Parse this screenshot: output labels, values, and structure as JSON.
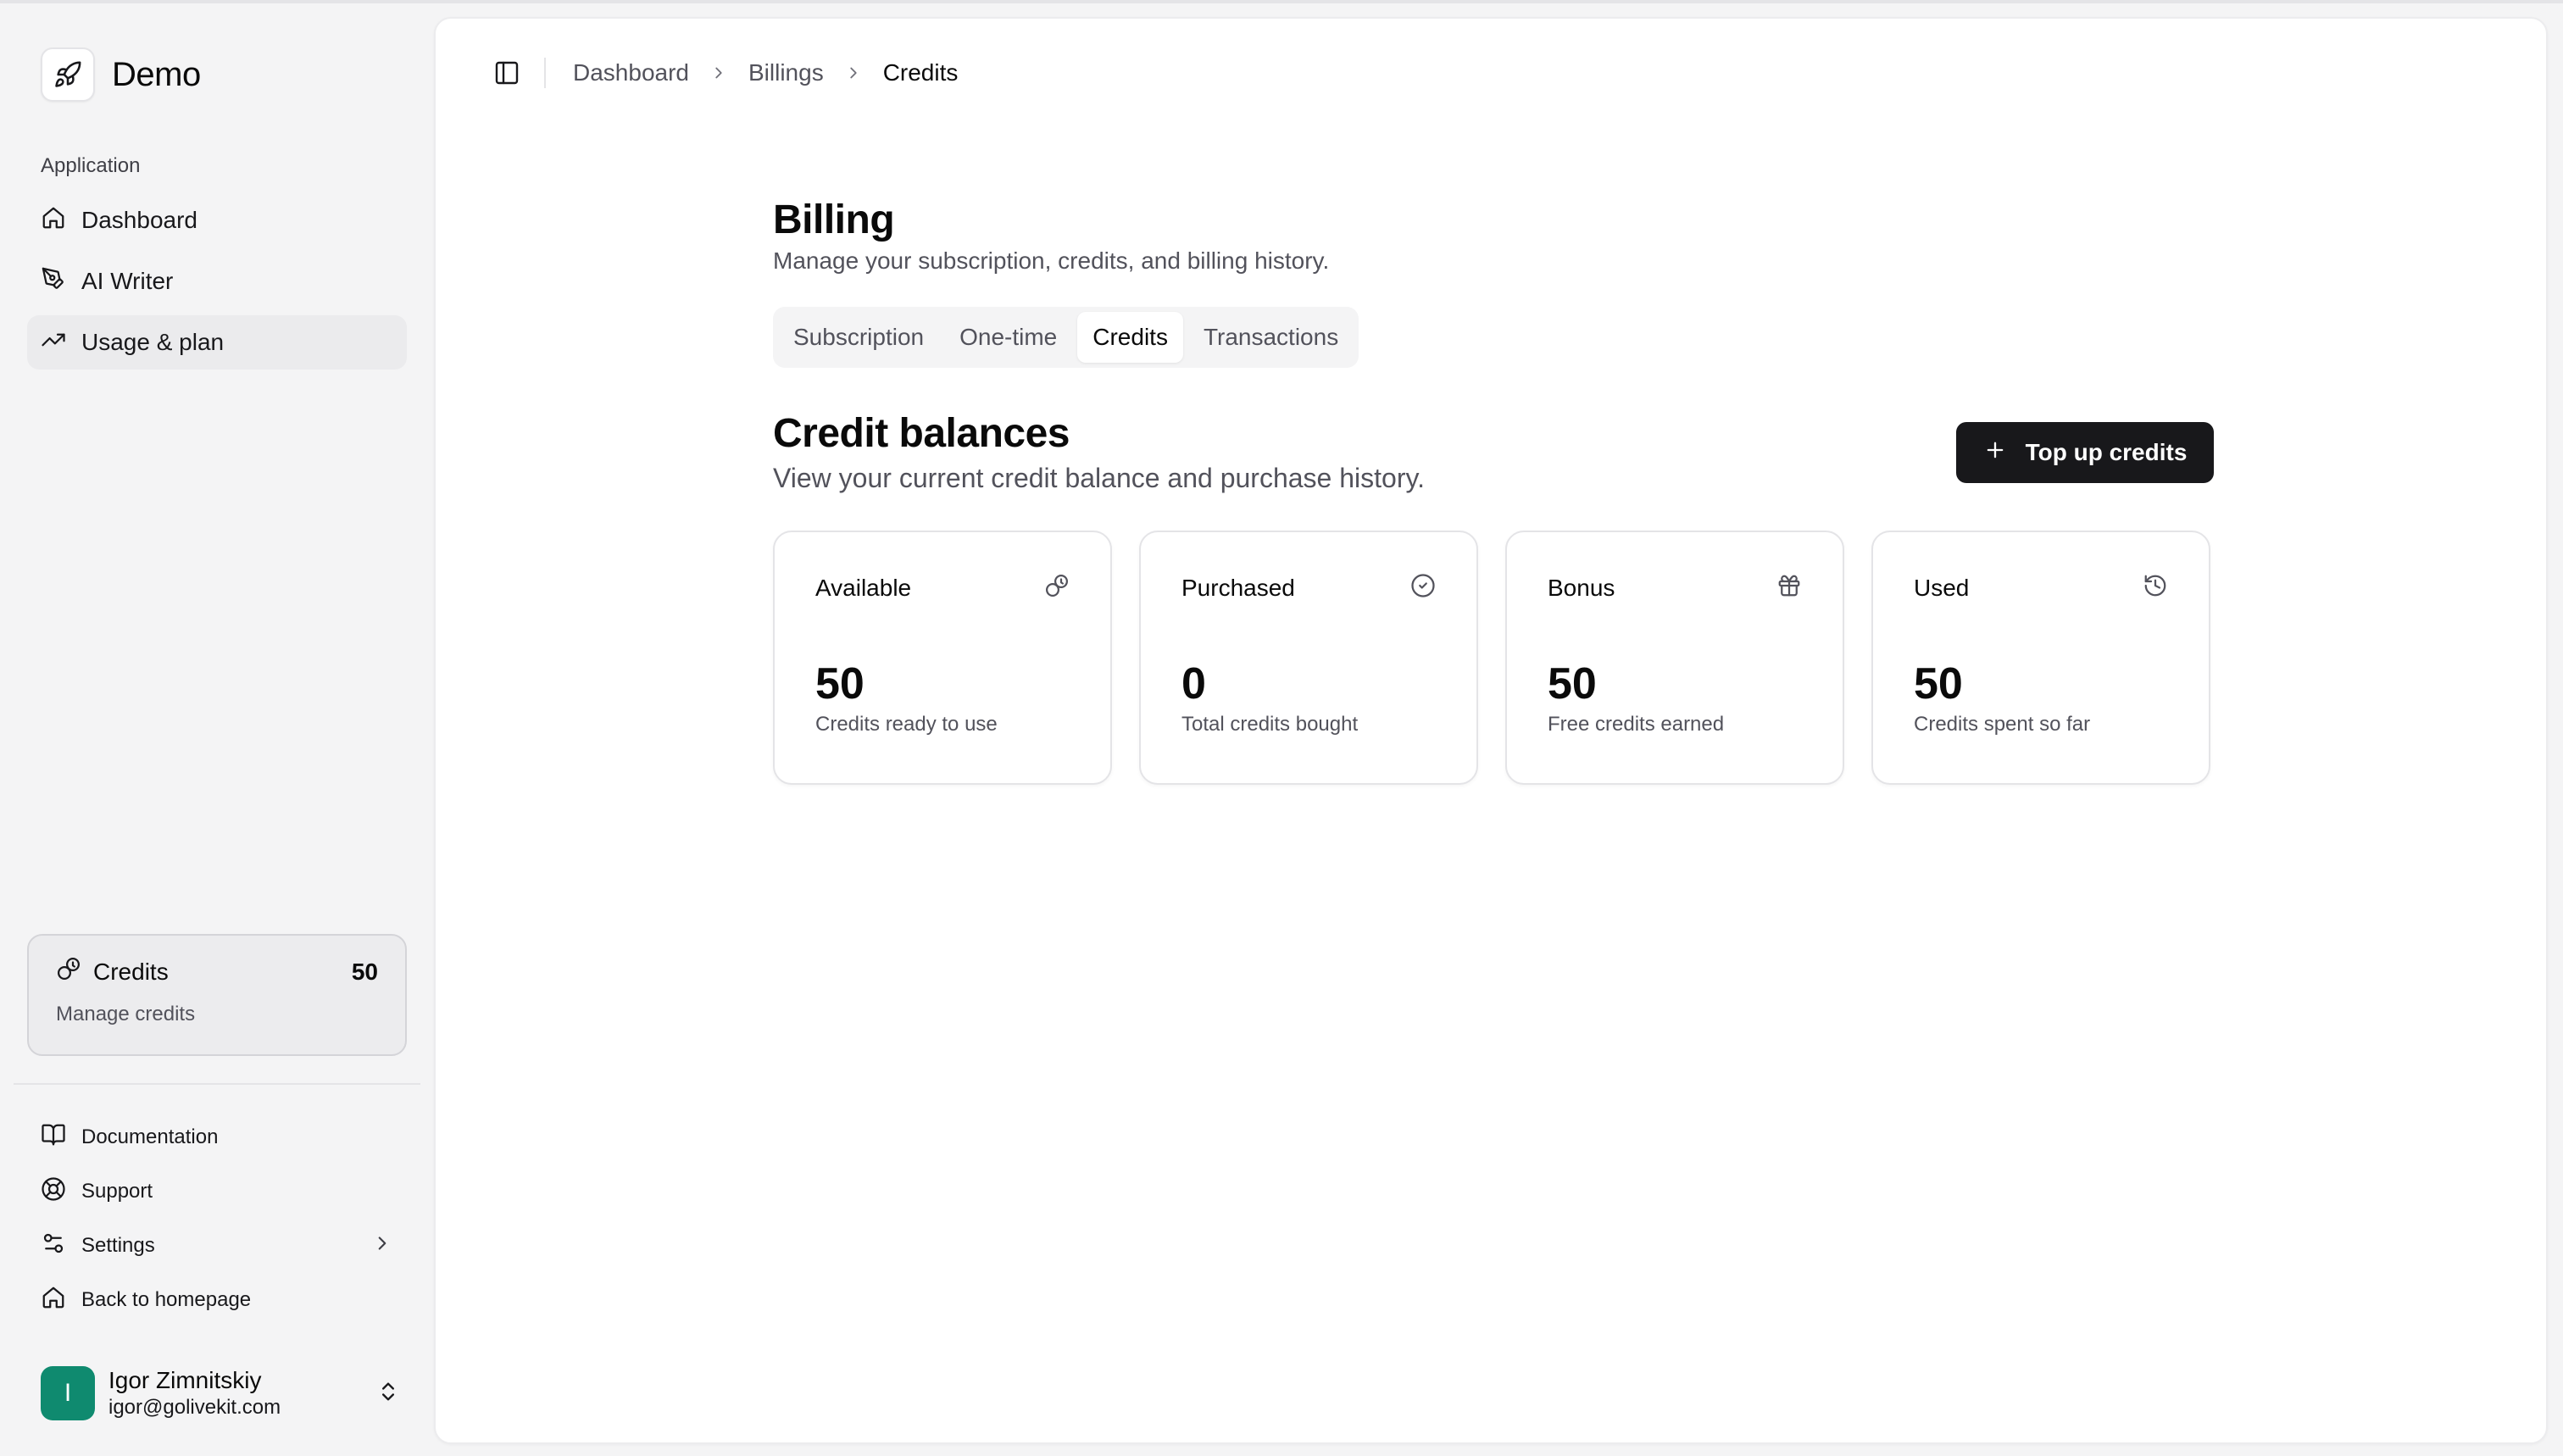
{
  "app": {
    "name": "Demo"
  },
  "sidebar": {
    "section_label": "Application",
    "items": [
      {
        "label": "Dashboard",
        "icon": "home-icon"
      },
      {
        "label": "AI Writer",
        "icon": "pen-tool-icon"
      },
      {
        "label": "Usage & plan",
        "icon": "trending-up-icon",
        "active": true
      }
    ],
    "credits": {
      "label": "Credits",
      "count": "50",
      "sub": "Manage credits"
    },
    "bottom_items": [
      {
        "label": "Documentation",
        "icon": "book-open-icon"
      },
      {
        "label": "Support",
        "icon": "life-buoy-icon"
      },
      {
        "label": "Settings",
        "icon": "settings-sliders-icon"
      },
      {
        "label": "Back to homepage",
        "icon": "home-icon"
      }
    ],
    "user": {
      "initial": "I",
      "name": "Igor Zimnitskiy",
      "email": "igor@golivekit.com"
    }
  },
  "breadcrumb": [
    "Dashboard",
    "Billings",
    "Credits"
  ],
  "page": {
    "title": "Billing",
    "subtitle": "Manage your subscription, credits, and billing history.",
    "tabs": [
      "Subscription",
      "One-time",
      "Credits",
      "Transactions"
    ],
    "active_tab": "Credits"
  },
  "credits_section": {
    "title": "Credit balances",
    "subtitle": "View your current credit balance and purchase history.",
    "topup_label": "Top up credits",
    "cards": [
      {
        "label": "Available",
        "value": "50",
        "desc": "Credits ready to use",
        "icon": "coins-icon"
      },
      {
        "label": "Purchased",
        "value": "0",
        "desc": "Total credits bought",
        "icon": "check-circle-icon"
      },
      {
        "label": "Bonus",
        "value": "50",
        "desc": "Free credits earned",
        "icon": "gift-icon"
      },
      {
        "label": "Used",
        "value": "50",
        "desc": "Credits spent so far",
        "icon": "history-icon"
      }
    ]
  },
  "colors": {
    "accent": "#18181b",
    "avatar": "#0f8a6f",
    "muted": "#52525b"
  }
}
